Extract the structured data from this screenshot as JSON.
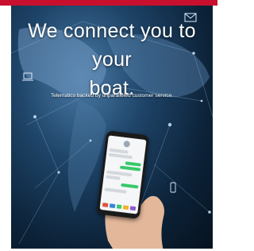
{
  "hero": {
    "headline_line1": "We connect you to your",
    "headline_line2": "boat.",
    "subheadline": "Telematics backed by unparalleled customer service."
  },
  "colors": {
    "brand_red": "#c8102e",
    "chat_green": "#38c96b"
  },
  "icons": [
    "mail-icon",
    "laptop-icon",
    "phone-icon"
  ]
}
